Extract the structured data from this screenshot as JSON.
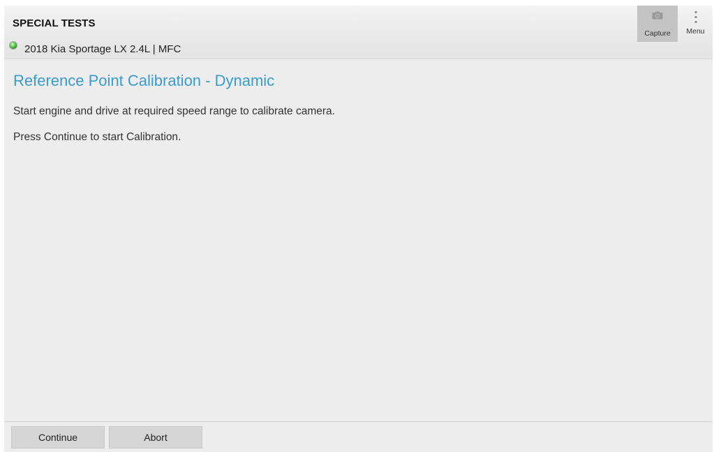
{
  "header": {
    "title": "SPECIAL TESTS",
    "vehicle": "2018 Kia Sportage LX 2.4L | MFC",
    "status_color": "#4fbf3a",
    "actions": [
      {
        "label": "Capture",
        "icon": "camera-icon"
      },
      {
        "label": "Menu",
        "icon": "vertical-dots-icon"
      }
    ]
  },
  "main": {
    "title": "Reference Point Calibration - Dynamic",
    "title_color": "#3a9ccd",
    "instructions": [
      "Start engine and drive at required speed range to calibrate camera.",
      "Press Continue to start Calibration."
    ]
  },
  "footer": {
    "buttons": [
      {
        "label": "Continue"
      },
      {
        "label": "Abort"
      }
    ]
  }
}
